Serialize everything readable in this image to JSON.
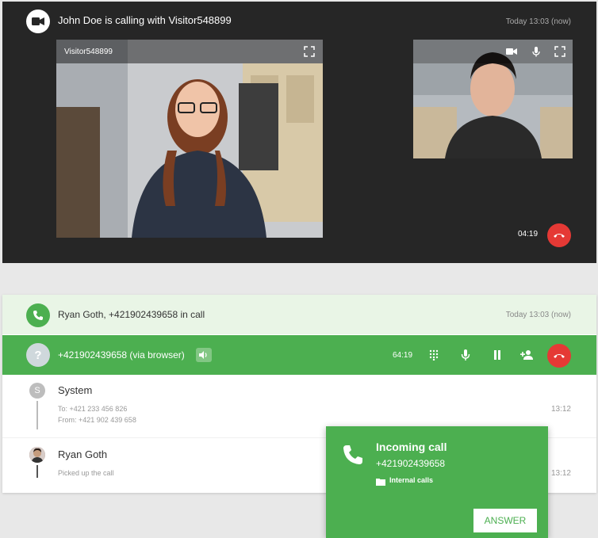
{
  "video_call": {
    "title": "John Doe is calling with Visitor548899",
    "time": "Today 13:03 (now)",
    "remote_name": "Visitor548899",
    "duration": "04:19",
    "icons": [
      "video-camera-icon",
      "fullscreen-icon",
      "microphone-icon",
      "hang-up-icon"
    ]
  },
  "ringing_call": {
    "label": "Ryan Goth, +421902439658 in call",
    "time": "Today 13:03 (now)"
  },
  "active_call": {
    "avatar": "?",
    "label": "+421902439658 (via browser)",
    "timer": "64:19",
    "controls": [
      "keypad-icon",
      "microphone-icon",
      "pause-icon",
      "add-person-icon",
      "hang-up-icon"
    ]
  },
  "events": [
    {
      "avatar": "S",
      "name": "System",
      "lines": [
        "To: +421 233 456 826",
        "From: +421 902 439 658"
      ],
      "time": "13:12"
    },
    {
      "name": "Ryan Goth",
      "lines": [
        "Picked up the call"
      ],
      "time": "13:12"
    }
  ],
  "incoming_call": {
    "title": "Incoming call",
    "number": "+421902439658",
    "group": "Internal calls",
    "answer_label": "ANSWER"
  },
  "colors": {
    "green": "#4caf50",
    "red": "#e53935",
    "dark_panel": "#262626",
    "ringing_bg": "#e9f5e6"
  }
}
